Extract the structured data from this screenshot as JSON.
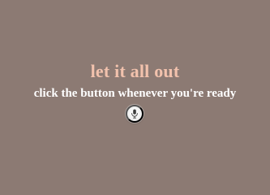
{
  "main": {
    "title": "let it all out",
    "subtitle": "click the button whenever you're ready"
  },
  "controls": {
    "record_button": {
      "icon": "microphone-icon"
    }
  },
  "theme": {
    "background": "#8c7a73",
    "title_color": "#f2c2ad",
    "subtitle_color": "#ffffff",
    "button_color": "#f3f3f3"
  }
}
